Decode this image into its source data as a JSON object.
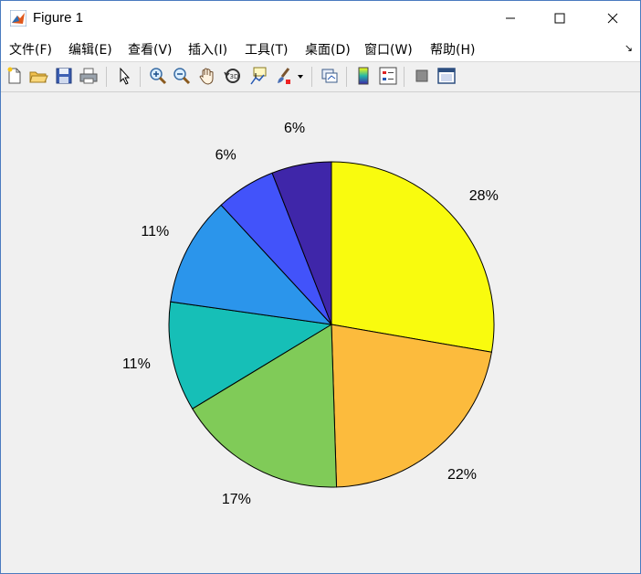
{
  "window": {
    "title": "Figure 1"
  },
  "menu": [
    {
      "label": "文件(F)"
    },
    {
      "label": "编辑(E)"
    },
    {
      "label": "查看(V)"
    },
    {
      "label": "插入(I)"
    },
    {
      "label": "工具(T)"
    },
    {
      "label": "桌面(D)"
    },
    {
      "label": "窗口(W)"
    },
    {
      "label": "帮助(H)"
    }
  ],
  "toolbar": {
    "icons": [
      "new-figure-icon",
      "open-file-icon",
      "save-icon",
      "print-icon",
      "select-arrow-icon",
      "zoom-in-icon",
      "zoom-out-icon",
      "pan-hand-icon",
      "rotate-3d-icon",
      "data-cursor-icon",
      "brush-icon",
      "link-plot-icon",
      "colorbar-icon",
      "legend-icon",
      "hide-plot-tools-icon",
      "show-plot-tools-icon"
    ]
  },
  "colors": {
    "slices": [
      "#f9fb0e",
      "#fcbb3d",
      "#80cb58",
      "#16bfb7",
      "#2b95eb",
      "#4253fa",
      "#3f26a9"
    ],
    "background": "#f0f0f0",
    "edge": "#000000"
  },
  "chart_data": {
    "type": "pie",
    "title": "",
    "start": "12 o'clock",
    "direction": "clockwise",
    "values": [
      28,
      22,
      17,
      11,
      11,
      6,
      6
    ],
    "labels": [
      "28%",
      "22%",
      "17%",
      "11%",
      "11%",
      "6%",
      "6%"
    ]
  }
}
